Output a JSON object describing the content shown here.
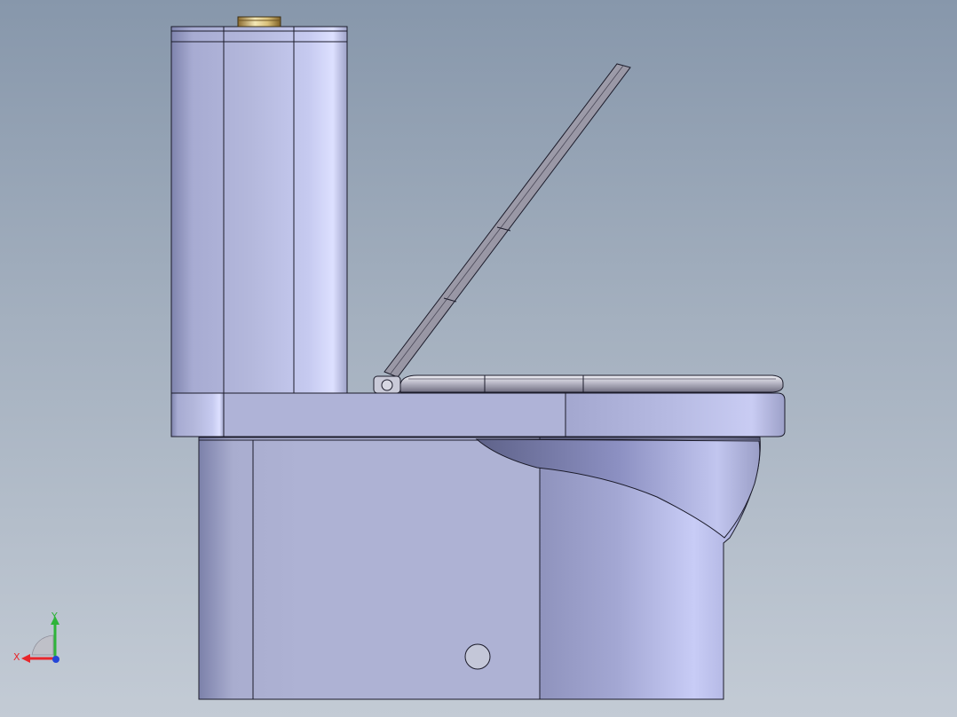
{
  "viewport": {
    "background_top": "#8797ab",
    "background_bottom": "#c3cbd5"
  },
  "model": {
    "parts": [
      "tank",
      "tank-cap-button",
      "seat-lid",
      "hinge",
      "seat-ring",
      "bowl-rim",
      "pedestal",
      "bowl",
      "drain-hole"
    ],
    "body_color": "#aeb2d6",
    "edge_color": "#1b1b2a"
  },
  "triad": {
    "x_label": "X",
    "y_label": "Y",
    "x_color": "#e8262b",
    "y_color": "#2fb43a",
    "z_color": "#2446d8"
  }
}
